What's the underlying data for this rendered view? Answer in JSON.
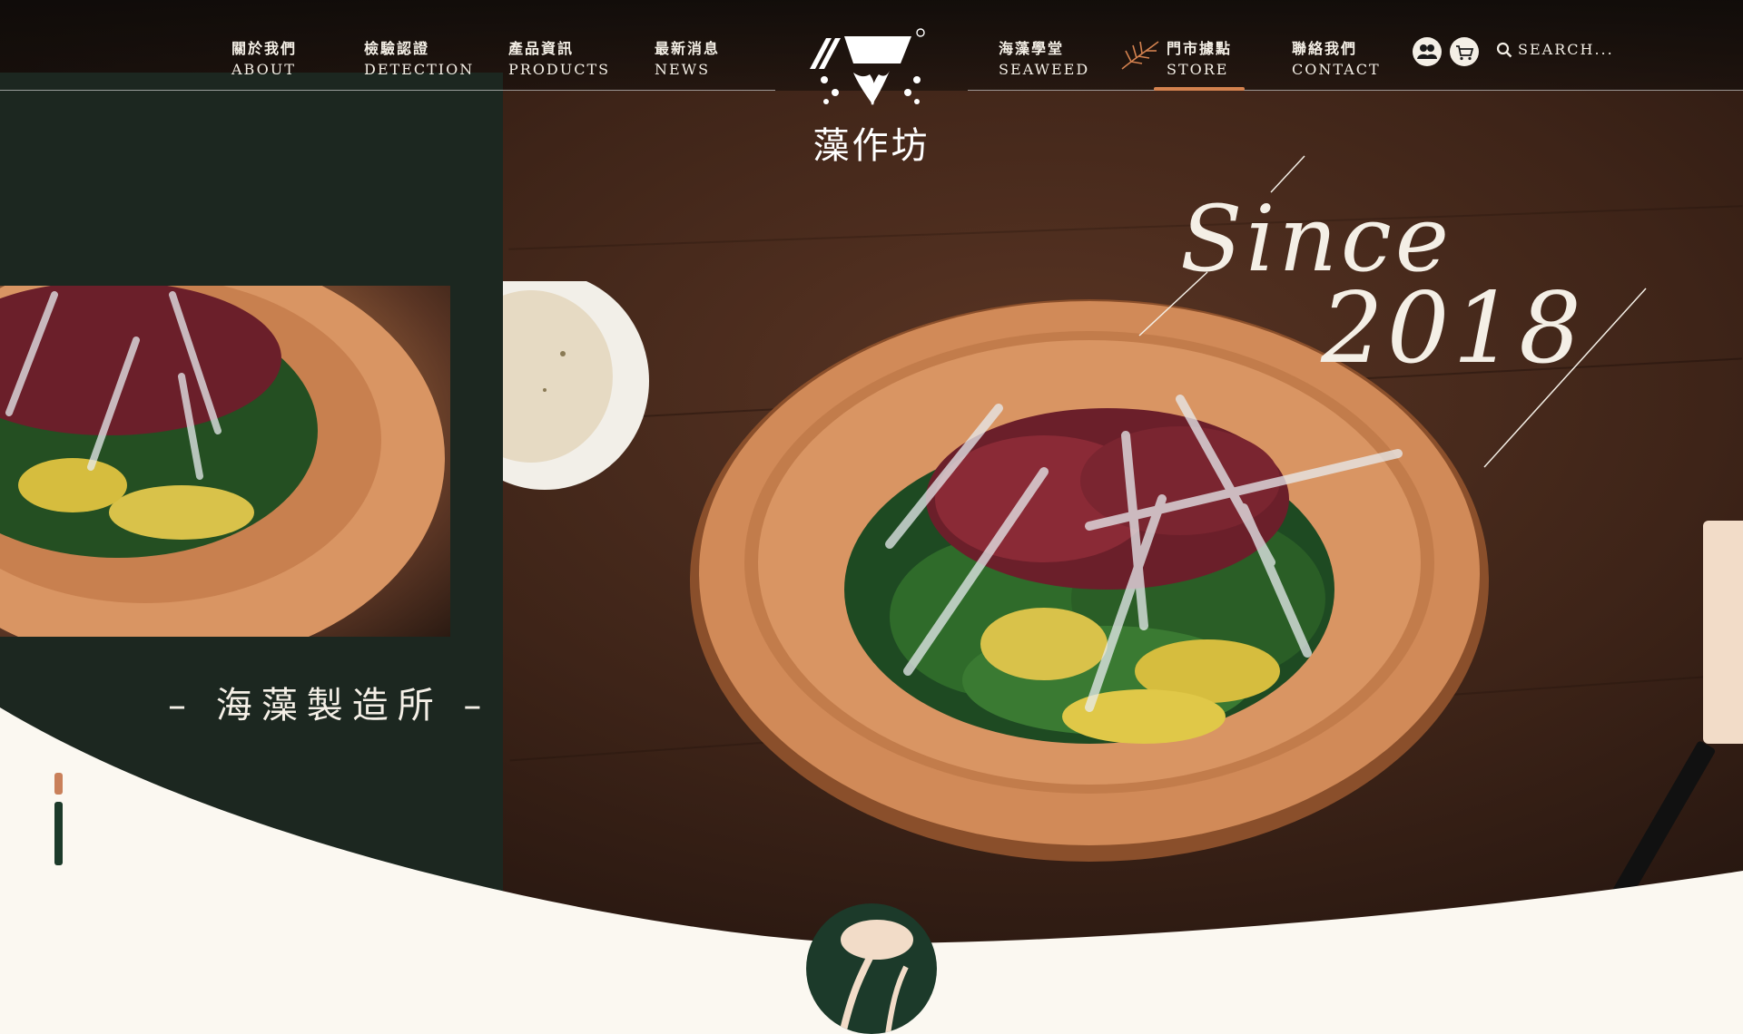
{
  "nav_left": [
    {
      "zh": "關於我們",
      "en": "ABOUT"
    },
    {
      "zh": "檢驗認證",
      "en": "DETECTION"
    },
    {
      "zh": "產品資訊",
      "en": "PRODUCTS"
    },
    {
      "zh": "最新消息",
      "en": "NEWS"
    }
  ],
  "nav_right": [
    {
      "zh": "海藻學堂",
      "en": "SEAWEED"
    },
    {
      "zh": "門市據點",
      "en": "STORE"
    },
    {
      "zh": "聯絡我們",
      "en": "CONTACT"
    }
  ],
  "logo": {
    "name": "藻作坊"
  },
  "search": {
    "label": "SEARCH..."
  },
  "hero": {
    "slogan": "– 海藻製造所 –",
    "since": "Since",
    "year": "2018"
  },
  "icons": {
    "member": "member-icon",
    "cart": "cart-icon",
    "search": "search-icon"
  },
  "colors": {
    "accent": "#d4824f",
    "panel": "#1c2720",
    "brand_green": "#1c3a2a",
    "cream": "#fbf8f1"
  }
}
